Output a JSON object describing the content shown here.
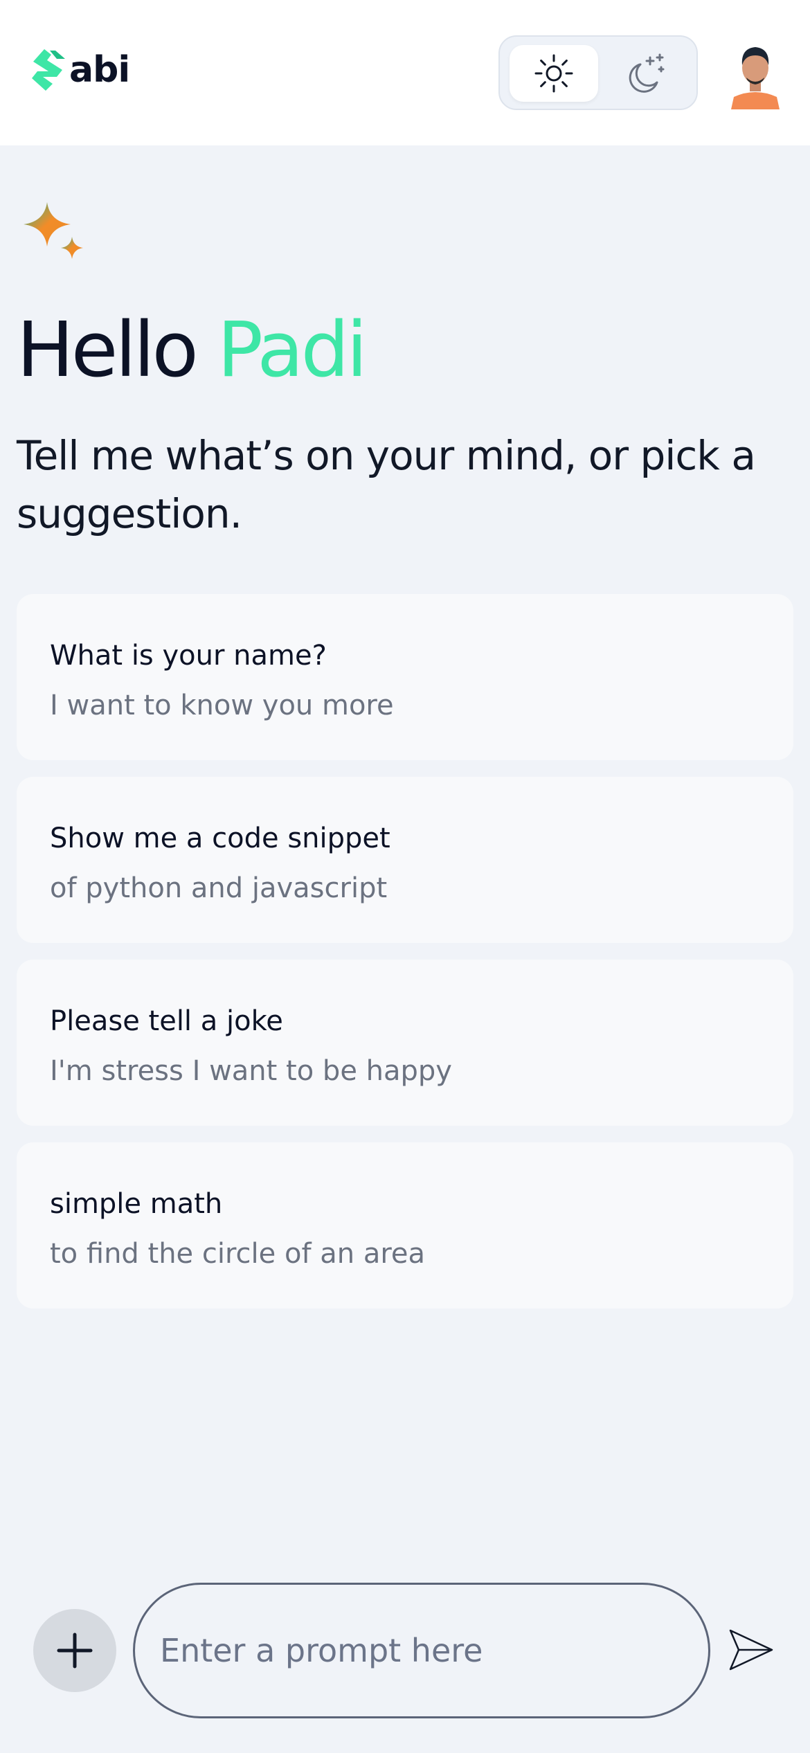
{
  "brand": {
    "name": "abi"
  },
  "greeting": {
    "hello": "Hello",
    "name": "Padi"
  },
  "subtitle": "Tell me what’s on your mind, or pick a suggestion.",
  "suggestions": [
    {
      "title": "What is your name?",
      "subtitle": "I want to know you more"
    },
    {
      "title": "Show me a code snippet",
      "subtitle": "of python and javascript"
    },
    {
      "title": "Please tell a joke",
      "subtitle": "I'm stress I want to be happy"
    },
    {
      "title": "simple math",
      "subtitle": "to find the circle of an area"
    }
  ],
  "prompt": {
    "placeholder": "Enter a prompt here",
    "value": ""
  },
  "icons": {
    "logo": "logo-mark-icon",
    "light_mode": "sun-icon",
    "dark_mode": "moon-stars-icon",
    "sparkle": "sparkle-icon",
    "add": "plus-icon",
    "send": "send-icon"
  },
  "colors": {
    "accent": "#3ee6a6",
    "background": "#f0f3f8",
    "card": "#f8f9fb",
    "sparkle_orange": "#f28c28",
    "sparkle_green": "#2fb58a"
  }
}
